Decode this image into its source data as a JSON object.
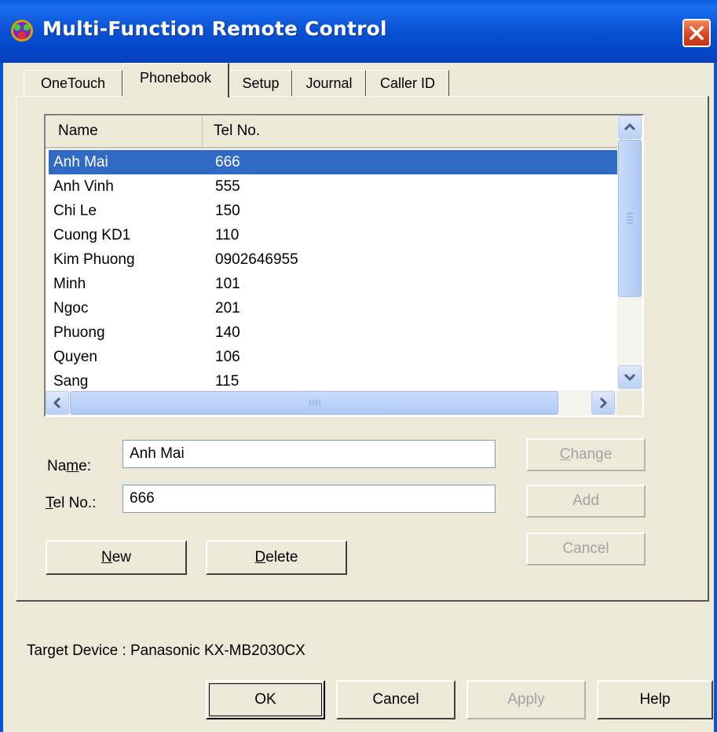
{
  "window": {
    "title": "Multi-Function Remote Control",
    "accent_color": "#0a53d6"
  },
  "tabs": [
    {
      "label": "OneTouch",
      "active": false
    },
    {
      "label": "Phonebook",
      "active": true
    },
    {
      "label": "Setup",
      "active": false
    },
    {
      "label": "Journal",
      "active": false
    },
    {
      "label": "Caller ID",
      "active": false
    }
  ],
  "phonebook": {
    "columns": [
      "Name",
      "Tel No."
    ],
    "entries": [
      {
        "name": "Anh Mai",
        "tel": "666",
        "selected": true
      },
      {
        "name": "Anh Vinh",
        "tel": "555"
      },
      {
        "name": "Chi Le",
        "tel": "150"
      },
      {
        "name": "Cuong KD1",
        "tel": "110"
      },
      {
        "name": "Kim Phuong",
        "tel": "0902646955"
      },
      {
        "name": "Minh",
        "tel": "101"
      },
      {
        "name": "Ngoc",
        "tel": "201"
      },
      {
        "name": "Phuong",
        "tel": "140"
      },
      {
        "name": "Quyen",
        "tel": "106"
      },
      {
        "name": "Sang",
        "tel": "115"
      }
    ],
    "selection_color": "#316ac5"
  },
  "form": {
    "name_label_pre": "Na",
    "name_label_mn": "m",
    "name_label_post": "e:",
    "name_value": "Anh Mai",
    "tel_label_mn": "T",
    "tel_label_post": "el No.:",
    "tel_value": "666"
  },
  "buttons": {
    "change_mn": "C",
    "change_rest": "hange",
    "add": "Add",
    "cancel_inner": "Cancel",
    "new_mn": "N",
    "new_rest": "ew",
    "delete_mn": "D",
    "delete_rest": "elete"
  },
  "footer": {
    "target_device": "Target Device : Panasonic KX-MB2030CX",
    "ok": "OK",
    "cancel": "Cancel",
    "apply": "Apply",
    "help": "Help"
  }
}
